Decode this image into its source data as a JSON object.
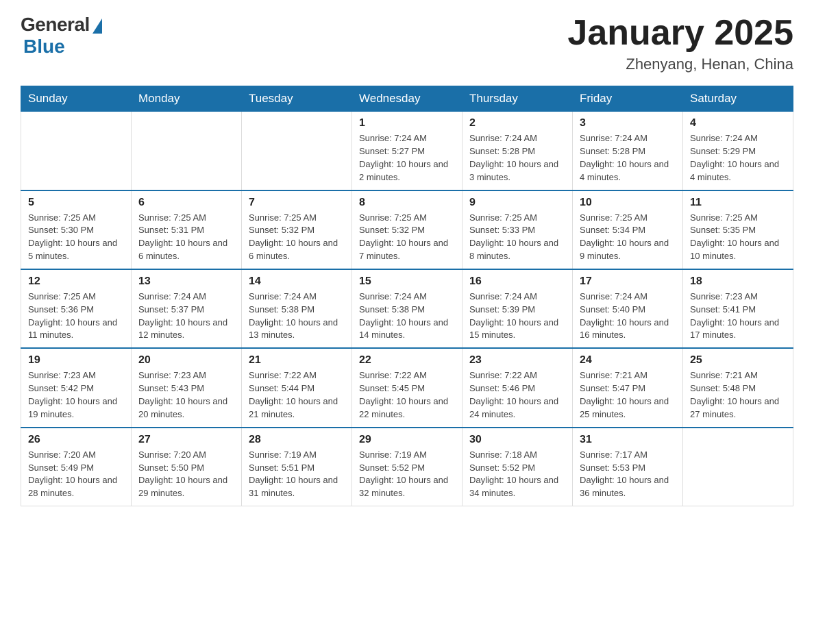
{
  "logo": {
    "general": "General",
    "blue": "Blue"
  },
  "title": "January 2025",
  "location": "Zhenyang, Henan, China",
  "days_of_week": [
    "Sunday",
    "Monday",
    "Tuesday",
    "Wednesday",
    "Thursday",
    "Friday",
    "Saturday"
  ],
  "weeks": [
    [
      {
        "day": "",
        "info": ""
      },
      {
        "day": "",
        "info": ""
      },
      {
        "day": "",
        "info": ""
      },
      {
        "day": "1",
        "info": "Sunrise: 7:24 AM\nSunset: 5:27 PM\nDaylight: 10 hours and 2 minutes."
      },
      {
        "day": "2",
        "info": "Sunrise: 7:24 AM\nSunset: 5:28 PM\nDaylight: 10 hours and 3 minutes."
      },
      {
        "day": "3",
        "info": "Sunrise: 7:24 AM\nSunset: 5:28 PM\nDaylight: 10 hours and 4 minutes."
      },
      {
        "day": "4",
        "info": "Sunrise: 7:24 AM\nSunset: 5:29 PM\nDaylight: 10 hours and 4 minutes."
      }
    ],
    [
      {
        "day": "5",
        "info": "Sunrise: 7:25 AM\nSunset: 5:30 PM\nDaylight: 10 hours and 5 minutes."
      },
      {
        "day": "6",
        "info": "Sunrise: 7:25 AM\nSunset: 5:31 PM\nDaylight: 10 hours and 6 minutes."
      },
      {
        "day": "7",
        "info": "Sunrise: 7:25 AM\nSunset: 5:32 PM\nDaylight: 10 hours and 6 minutes."
      },
      {
        "day": "8",
        "info": "Sunrise: 7:25 AM\nSunset: 5:32 PM\nDaylight: 10 hours and 7 minutes."
      },
      {
        "day": "9",
        "info": "Sunrise: 7:25 AM\nSunset: 5:33 PM\nDaylight: 10 hours and 8 minutes."
      },
      {
        "day": "10",
        "info": "Sunrise: 7:25 AM\nSunset: 5:34 PM\nDaylight: 10 hours and 9 minutes."
      },
      {
        "day": "11",
        "info": "Sunrise: 7:25 AM\nSunset: 5:35 PM\nDaylight: 10 hours and 10 minutes."
      }
    ],
    [
      {
        "day": "12",
        "info": "Sunrise: 7:25 AM\nSunset: 5:36 PM\nDaylight: 10 hours and 11 minutes."
      },
      {
        "day": "13",
        "info": "Sunrise: 7:24 AM\nSunset: 5:37 PM\nDaylight: 10 hours and 12 minutes."
      },
      {
        "day": "14",
        "info": "Sunrise: 7:24 AM\nSunset: 5:38 PM\nDaylight: 10 hours and 13 minutes."
      },
      {
        "day": "15",
        "info": "Sunrise: 7:24 AM\nSunset: 5:38 PM\nDaylight: 10 hours and 14 minutes."
      },
      {
        "day": "16",
        "info": "Sunrise: 7:24 AM\nSunset: 5:39 PM\nDaylight: 10 hours and 15 minutes."
      },
      {
        "day": "17",
        "info": "Sunrise: 7:24 AM\nSunset: 5:40 PM\nDaylight: 10 hours and 16 minutes."
      },
      {
        "day": "18",
        "info": "Sunrise: 7:23 AM\nSunset: 5:41 PM\nDaylight: 10 hours and 17 minutes."
      }
    ],
    [
      {
        "day": "19",
        "info": "Sunrise: 7:23 AM\nSunset: 5:42 PM\nDaylight: 10 hours and 19 minutes."
      },
      {
        "day": "20",
        "info": "Sunrise: 7:23 AM\nSunset: 5:43 PM\nDaylight: 10 hours and 20 minutes."
      },
      {
        "day": "21",
        "info": "Sunrise: 7:22 AM\nSunset: 5:44 PM\nDaylight: 10 hours and 21 minutes."
      },
      {
        "day": "22",
        "info": "Sunrise: 7:22 AM\nSunset: 5:45 PM\nDaylight: 10 hours and 22 minutes."
      },
      {
        "day": "23",
        "info": "Sunrise: 7:22 AM\nSunset: 5:46 PM\nDaylight: 10 hours and 24 minutes."
      },
      {
        "day": "24",
        "info": "Sunrise: 7:21 AM\nSunset: 5:47 PM\nDaylight: 10 hours and 25 minutes."
      },
      {
        "day": "25",
        "info": "Sunrise: 7:21 AM\nSunset: 5:48 PM\nDaylight: 10 hours and 27 minutes."
      }
    ],
    [
      {
        "day": "26",
        "info": "Sunrise: 7:20 AM\nSunset: 5:49 PM\nDaylight: 10 hours and 28 minutes."
      },
      {
        "day": "27",
        "info": "Sunrise: 7:20 AM\nSunset: 5:50 PM\nDaylight: 10 hours and 29 minutes."
      },
      {
        "day": "28",
        "info": "Sunrise: 7:19 AM\nSunset: 5:51 PM\nDaylight: 10 hours and 31 minutes."
      },
      {
        "day": "29",
        "info": "Sunrise: 7:19 AM\nSunset: 5:52 PM\nDaylight: 10 hours and 32 minutes."
      },
      {
        "day": "30",
        "info": "Sunrise: 7:18 AM\nSunset: 5:52 PM\nDaylight: 10 hours and 34 minutes."
      },
      {
        "day": "31",
        "info": "Sunrise: 7:17 AM\nSunset: 5:53 PM\nDaylight: 10 hours and 36 minutes."
      },
      {
        "day": "",
        "info": ""
      }
    ]
  ]
}
